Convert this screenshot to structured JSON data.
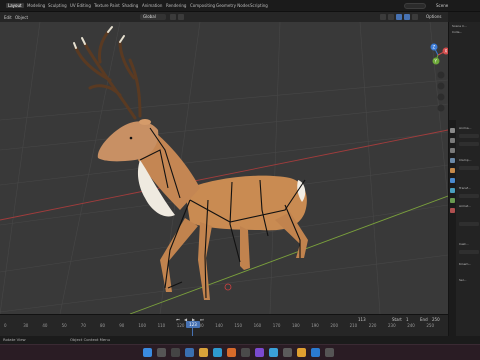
{
  "topbar": {
    "workspaces": [
      "Layout",
      "Modeling",
      "Sculpting",
      "UV Editing",
      "Texture Paint",
      "Shading",
      "Animation",
      "Rendering",
      "Compositing",
      "Geometry Nodes",
      "Scripting"
    ],
    "scene_label": "Scene"
  },
  "viewport_header": {
    "menus": [
      "Edit",
      "Object"
    ],
    "mode": "Global",
    "options_label": "Options"
  },
  "gizmo": {
    "x": "X",
    "y": "Y",
    "z": "Z"
  },
  "timeline": {
    "ticks": [
      "0",
      "30",
      "40",
      "50",
      "70",
      "80",
      "90",
      "100",
      "110",
      "120",
      "130",
      "140",
      "150",
      "160",
      "170",
      "180",
      "190",
      "200",
      "210",
      "220",
      "230",
      "240",
      "250"
    ],
    "current_frame": "123",
    "start_label": "Start",
    "start_value": "1",
    "end_label": "End",
    "end_value": "250",
    "frame_field": "113"
  },
  "statusbar": {
    "left": "Rotate View",
    "mid": "Object Context Menu"
  },
  "right_panel": {
    "rows": [
      "Scene C...",
      "Colle...",
      "",
      "",
      "",
      "",
      "Anima...",
      "",
      "",
      "",
      "Clamp...",
      "",
      "Transf...",
      "",
      "Armat...",
      "",
      "",
      "Cast...",
      "",
      "Kinem...",
      "Sel..."
    ]
  },
  "colors": {
    "accent": "#4772b3",
    "viewport_bg": "#393939",
    "grid_red": "#a23c3c",
    "grid_green": "#7aa03c"
  }
}
